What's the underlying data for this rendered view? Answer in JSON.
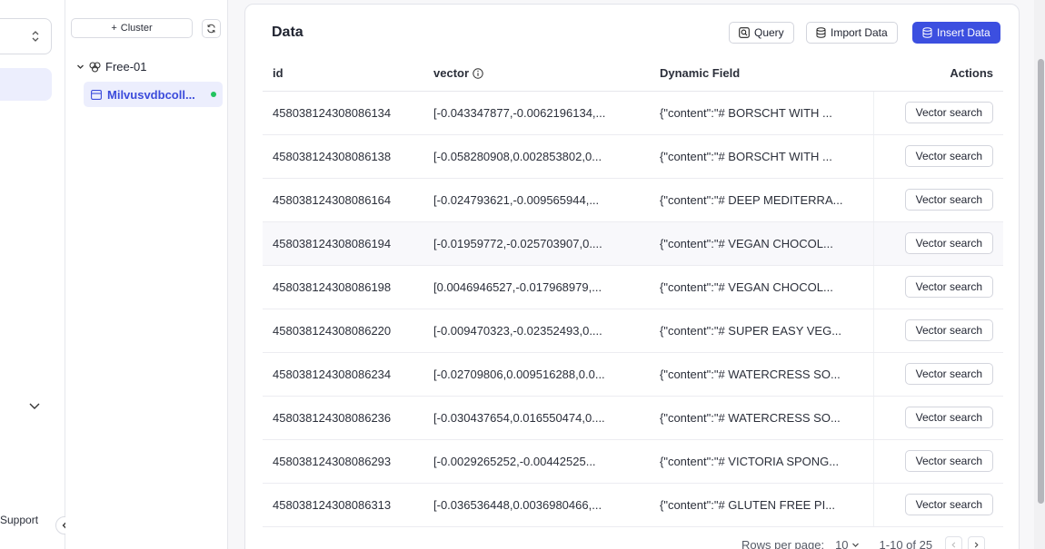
{
  "nav": {
    "support_label": "Support"
  },
  "tree": {
    "cluster_button_label": "Cluster",
    "cluster_name": "Free-01",
    "collection_name": "Milvusvdbcoll..."
  },
  "main": {
    "title": "Data",
    "query_label": "Query",
    "import_label": "Import Data",
    "insert_label": "Insert Data",
    "columns": [
      "id",
      "vector",
      "Dynamic Field",
      "Actions"
    ],
    "action_label": "Vector search",
    "rows": [
      {
        "id": "458038124308086134",
        "vector": "[-0.043347877,-0.0062196134,...",
        "dynamic": "{\"content\":\"# BORSCHT WITH ..."
      },
      {
        "id": "458038124308086138",
        "vector": "[-0.058280908,0.002853802,0...",
        "dynamic": "{\"content\":\"# BORSCHT WITH ..."
      },
      {
        "id": "458038124308086164",
        "vector": "[-0.024793621,-0.009565944,...",
        "dynamic": "{\"content\":\"# DEEP MEDITERRA..."
      },
      {
        "id": "458038124308086194",
        "vector": "[-0.01959772,-0.025703907,0....",
        "dynamic": "{\"content\":\"# VEGAN CHOCOL..."
      },
      {
        "id": "458038124308086198",
        "vector": "[0.0046946527,-0.017968979,...",
        "dynamic": "{\"content\":\"# VEGAN CHOCOL..."
      },
      {
        "id": "458038124308086220",
        "vector": "[-0.009470323,-0.02352493,0....",
        "dynamic": "{\"content\":\"# SUPER EASY VEG..."
      },
      {
        "id": "458038124308086234",
        "vector": "[-0.02709806,0.009516288,0.0...",
        "dynamic": "{\"content\":\"# WATERCRESS SO..."
      },
      {
        "id": "458038124308086236",
        "vector": "[-0.030437654,0.016550474,0....",
        "dynamic": "{\"content\":\"# WATERCRESS SO..."
      },
      {
        "id": "458038124308086293",
        "vector": "[-0.0029265252,-0.00442525...",
        "dynamic": "{\"content\":\"# VICTORIA SPONG..."
      },
      {
        "id": "458038124308086313",
        "vector": "[-0.036536448,0.0036980466,...",
        "dynamic": "{\"content\":\"# GLUTEN FREE PI..."
      }
    ],
    "highlighted_row_index": 3
  },
  "pagination": {
    "rows_per_page_label": "Rows per page:",
    "rows_per_page_value": "10",
    "range_text": "1-10 of 25"
  },
  "colors": {
    "accent": "#3c4fe0",
    "active_bg": "#eceefd",
    "status_dot": "#22c35e"
  }
}
